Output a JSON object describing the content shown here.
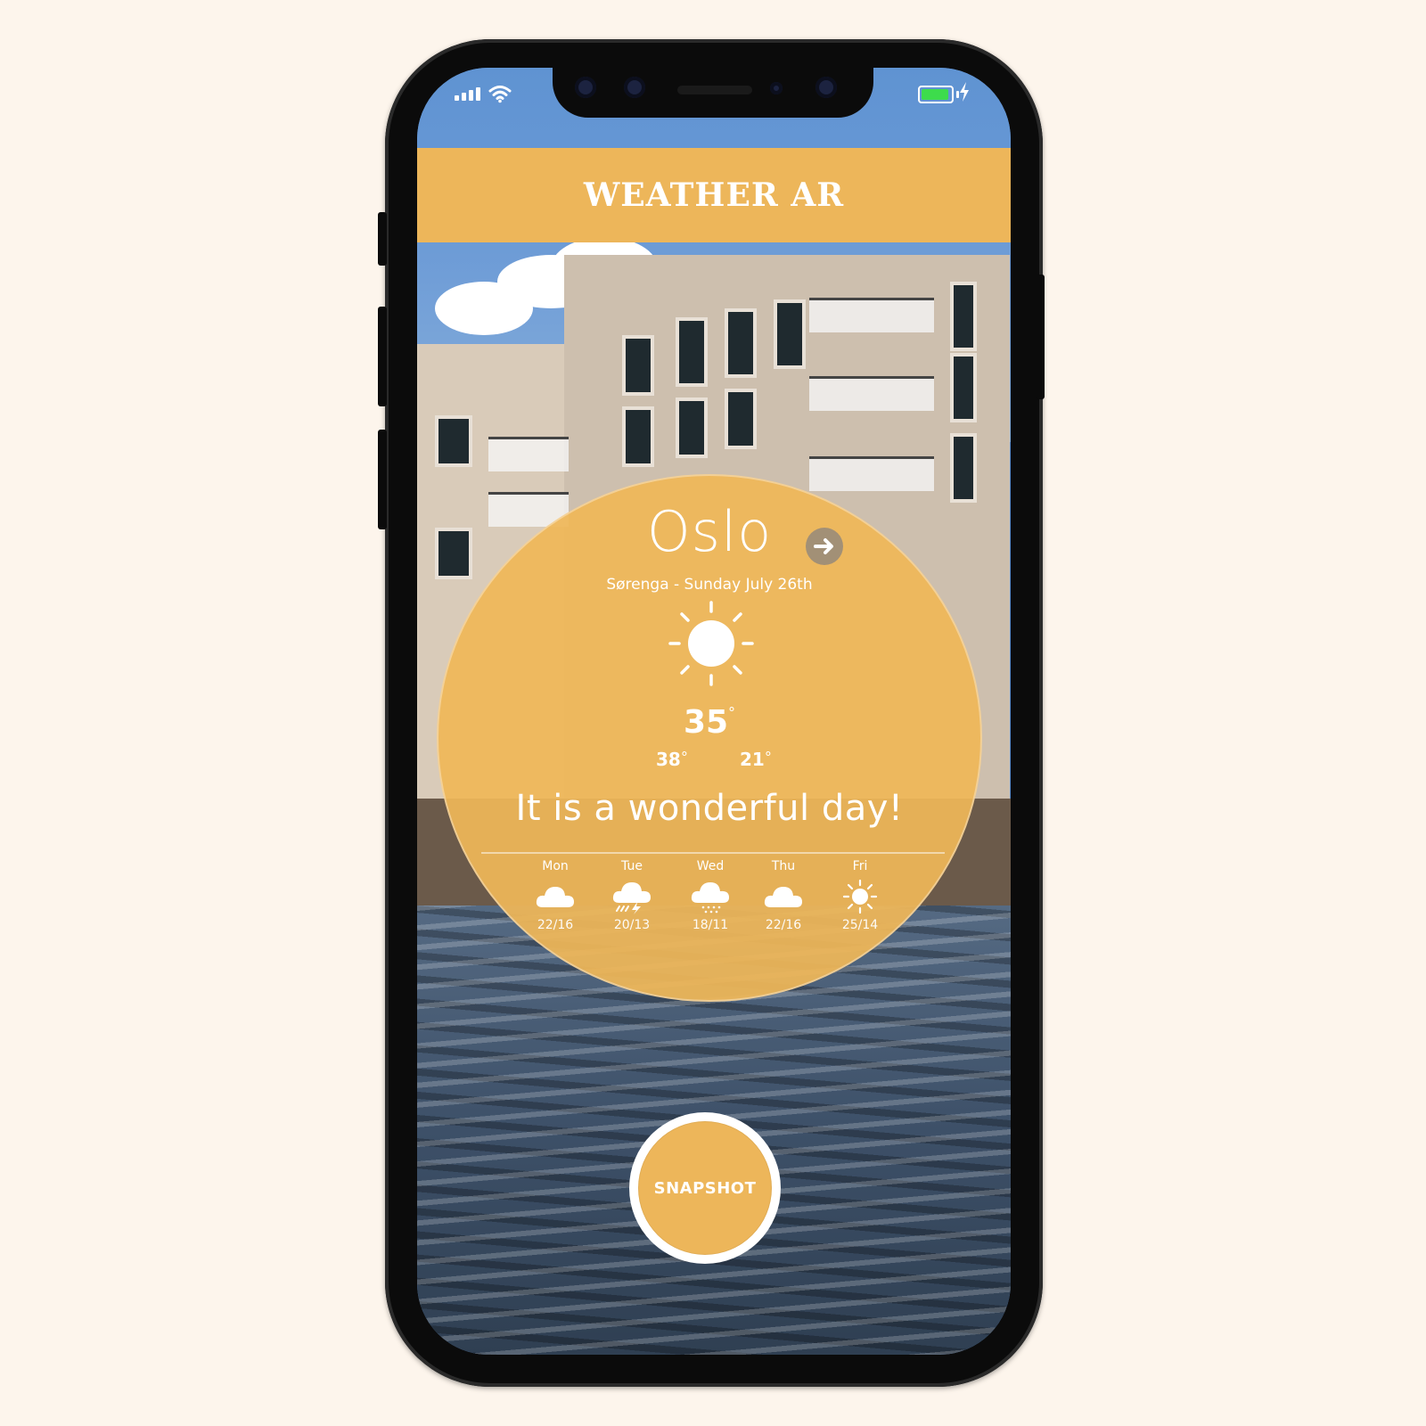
{
  "app": {
    "title": "WEATHER AR"
  },
  "weather": {
    "city": "Oslo",
    "subtitle": "Sørenga - Sunday July 26th",
    "condition_icon": "sun-icon",
    "temperature": "35",
    "high": "38",
    "low": "21",
    "degree_symbol": "°",
    "message": "It is a wonderful day!"
  },
  "forecast": [
    {
      "day": "Mon",
      "icon": "cloud-icon",
      "range": "22/16"
    },
    {
      "day": "Tue",
      "icon": "thunderstorm-icon",
      "range": "20/13"
    },
    {
      "day": "Wed",
      "icon": "snow-cloud-icon",
      "range": "18/11"
    },
    {
      "day": "Thu",
      "icon": "cloud-icon",
      "range": "22/16"
    },
    {
      "day": "Fri",
      "icon": "sun-icon",
      "range": "25/14"
    }
  ],
  "snapshot": {
    "label": "SNAPSHOT"
  },
  "colors": {
    "accent": "#edb65a",
    "background": "#fdf5ec",
    "battery": "#3ddc4c"
  }
}
